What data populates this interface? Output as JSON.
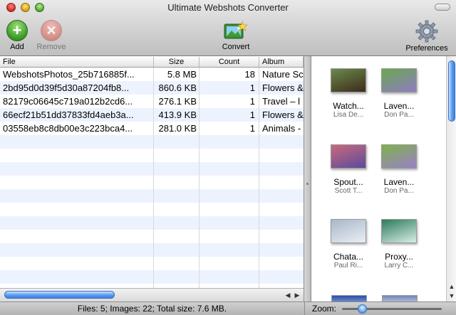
{
  "window": {
    "title": "Ultimate Webshots Converter"
  },
  "toolbar": {
    "add_label": "Add",
    "remove_label": "Remove",
    "convert_label": "Convert",
    "preferences_label": "Preferences"
  },
  "table": {
    "columns": [
      "File",
      "Size",
      "Count",
      "Album"
    ],
    "rows": [
      {
        "file": "WebshotsPhotos_25b716885f...",
        "size": "5.8 MB",
        "count": "18",
        "album": "Nature Sc"
      },
      {
        "file": "2bd95d0d39f5d30a87204fb8...",
        "size": "860.6 KB",
        "count": "1",
        "album": "Flowers &"
      },
      {
        "file": "82179c06645c719a012b2cd6...",
        "size": "276.1 KB",
        "count": "1",
        "album": "Travel – l"
      },
      {
        "file": "66ecf21b51dd37833fd4aeb3a...",
        "size": "413.9 KB",
        "count": "1",
        "album": "Flowers &"
      },
      {
        "file": "03558eb8c8db00e3c223bca4...",
        "size": "281.0 KB",
        "count": "1",
        "album": "Animals -"
      }
    ]
  },
  "thumbnails": [
    {
      "name": "Watch...",
      "author": "Lisa De...",
      "colors": [
        "#6b8a4a",
        "#3d2a1c"
      ]
    },
    {
      "name": "Laven...",
      "author": "Don Pa...",
      "colors": [
        "#6aa84f",
        "#8e7cc3"
      ]
    },
    {
      "name": "Spout...",
      "author": "Scott T...",
      "colors": [
        "#c96a7e",
        "#5b4a9a"
      ]
    },
    {
      "name": "Laven...",
      "author": "Don Pa...",
      "colors": [
        "#7fb24a",
        "#9a7fc9"
      ]
    },
    {
      "name": "Chata...",
      "author": "Paul Ri...",
      "colors": [
        "#a9b7c9",
        "#e9eef4"
      ]
    },
    {
      "name": "Proxy...",
      "author": "Larry C...",
      "colors": [
        "#2c7a5a",
        "#d8efe8"
      ]
    }
  ],
  "status": {
    "text": "Files: 5; Images: 22; Total size: 7.6 MB."
  },
  "zoom": {
    "label": "Zoom:",
    "level": 0.2
  }
}
